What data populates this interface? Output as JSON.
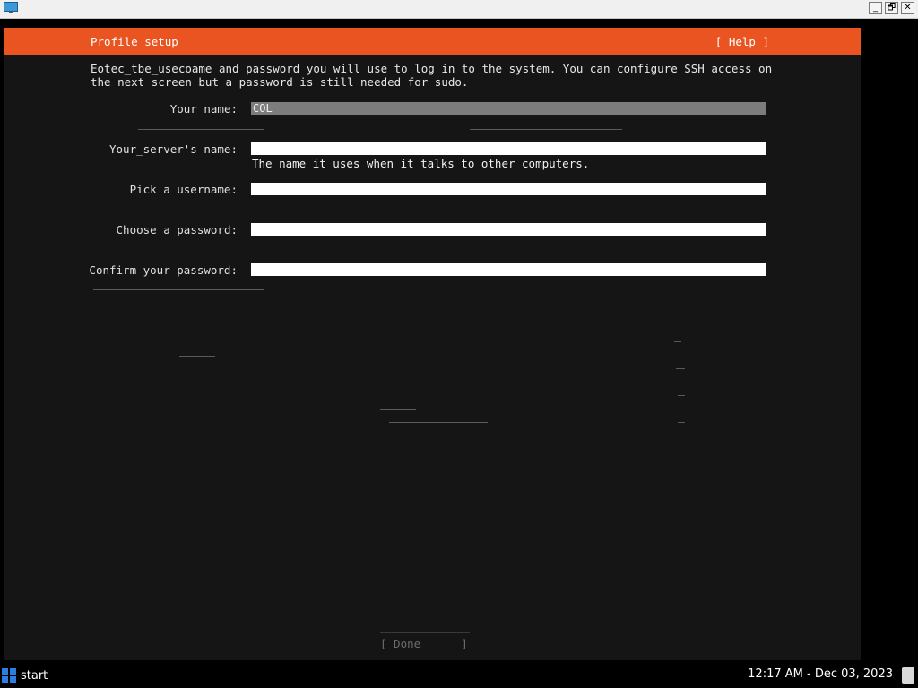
{
  "window": {
    "minimize_label": "_",
    "maximize_label": "🗗",
    "close_label": "✕"
  },
  "installer": {
    "header_title": "Profile setup",
    "help_label": "[ Help ]",
    "intro_text": "Eotec_tbe_usecoame and password you will use to log in to the system. You can configure SSH access on\nthe next screen but a password is still needed for sudo.",
    "fields": {
      "your_name_label": "Your name:",
      "your_name_value": "COL",
      "server_name_label": "Your_server's name:",
      "server_name_value": "",
      "server_name_help": "The name it uses when it talks to other computers.",
      "username_label": "Pick a username:",
      "username_value": "",
      "password_label": "Choose a password:",
      "password_value": "",
      "confirm_label": "Confirm your password:",
      "confirm_value": ""
    },
    "done_label": "[ Done      ]"
  },
  "taskbar": {
    "start_label": "start",
    "clock": "12:17 AM - Dec 03, 2023"
  },
  "colors": {
    "header": "#e95420",
    "background": "#151515",
    "accent_start": "#2a7de1"
  }
}
